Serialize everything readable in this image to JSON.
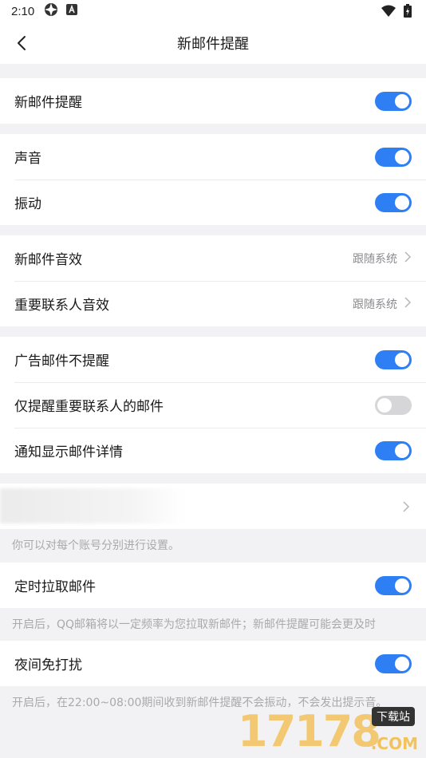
{
  "status_bar": {
    "time": "2:10"
  },
  "header": {
    "title": "新邮件提醒"
  },
  "section1": {
    "new_mail_alert": {
      "label": "新邮件提醒",
      "on": true
    }
  },
  "section2": {
    "sound": {
      "label": "声音",
      "on": true
    },
    "vibrate": {
      "label": "振动",
      "on": true
    }
  },
  "section3": {
    "new_mail_sound": {
      "label": "新邮件音效",
      "value": "跟随系统"
    },
    "vip_sound": {
      "label": "重要联系人音效",
      "value": "跟随系统"
    }
  },
  "section4": {
    "ad_mail_no_alert": {
      "label": "广告邮件不提醒",
      "on": true
    },
    "only_vip": {
      "label": "仅提醒重要联系人的邮件",
      "on": false
    },
    "show_details": {
      "label": "通知显示邮件详情",
      "on": true
    }
  },
  "account": {
    "hint": "你可以对每个账号分别进行设置。"
  },
  "scheduled_fetch": {
    "label": "定时拉取邮件",
    "on": true,
    "hint": "开启后，QQ邮箱将以一定频率为您拉取新邮件；新邮件提醒可能会更及时"
  },
  "night_mode": {
    "label": "夜间免打扰",
    "on": true,
    "hint": "开启后，在22:00~08:00期间收到新邮件提醒不会振动，不会发出提示音。"
  },
  "watermark": {
    "digits": "17178",
    "tag": "下载站",
    "domain": ".COM"
  },
  "colors": {
    "toggle_on": "#2f7ff4",
    "toggle_off": "#d6d6d9",
    "page_bg": "#f2f2f4"
  }
}
